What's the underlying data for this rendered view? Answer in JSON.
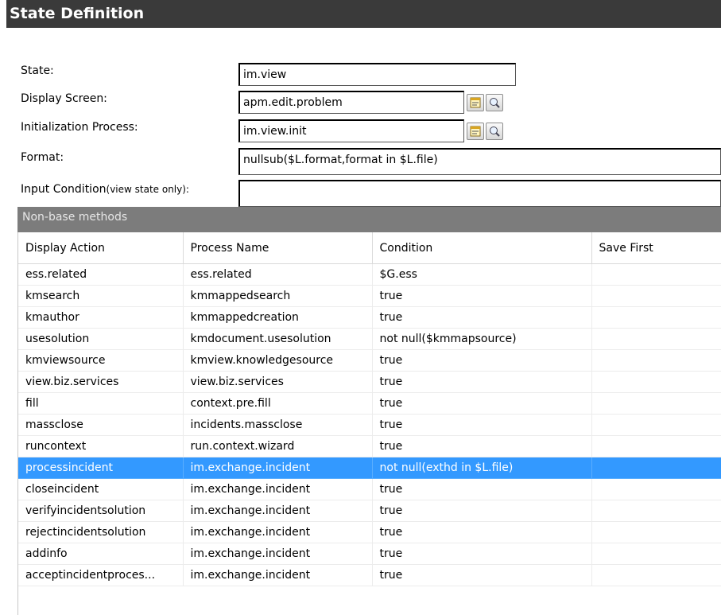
{
  "title": "State Definition",
  "fields": {
    "state": {
      "label": "State:",
      "value": "im.view"
    },
    "display_screen": {
      "label": "Display Screen:",
      "value": "apm.edit.problem"
    },
    "init_process": {
      "label": "Initialization Process:",
      "value": "im.view.init"
    },
    "format": {
      "label": "Format:",
      "value": "nullsub($L.format,format in $L.file)"
    },
    "input_condition": {
      "label": "Input Condition",
      "note": "(view state only):",
      "value": ""
    }
  },
  "section": {
    "title": "Non-base methods"
  },
  "table": {
    "columns": [
      "Display Action",
      "Process Name",
      "Condition",
      "Save First"
    ],
    "rows": [
      [
        "ess.related",
        "ess.related",
        "$G.ess",
        ""
      ],
      [
        "kmsearch",
        "kmmappedsearch",
        "true",
        ""
      ],
      [
        "kmauthor",
        "kmmappedcreation",
        "true",
        ""
      ],
      [
        "usesolution",
        "kmdocument.usesolution",
        "not null($kmmapsource)",
        ""
      ],
      [
        "kmviewsource",
        "kmview.knowledgesource",
        "true",
        ""
      ],
      [
        "view.biz.services",
        "view.biz.services",
        "true",
        ""
      ],
      [
        "fill",
        "context.pre.fill",
        "true",
        ""
      ],
      [
        "massclose",
        "incidents.massclose",
        "true",
        ""
      ],
      [
        "runcontext",
        "run.context.wizard",
        "true",
        ""
      ],
      [
        "processincident",
        "im.exchange.incident",
        "not null(exthd in $L.file)",
        ""
      ],
      [
        "closeincident",
        "im.exchange.incident",
        "true",
        ""
      ],
      [
        "verifyincidentsolution",
        "im.exchange.incident",
        "true",
        ""
      ],
      [
        "rejectincidentsolution",
        "im.exchange.incident",
        "true",
        ""
      ],
      [
        "addinfo",
        "im.exchange.incident",
        "true",
        ""
      ],
      [
        "acceptincidentproces...",
        "im.exchange.incident",
        "true",
        ""
      ]
    ],
    "selected_row": 9
  },
  "icons": {
    "lookup_display_screen": "record-lookup-icon",
    "search_display_screen": "magnifier-icon",
    "lookup_init_process": "record-lookup-icon",
    "search_init_process": "magnifier-icon"
  },
  "colors": {
    "title_bar": "#3a3a3a",
    "section_bar": "#7c7c7c",
    "selection": "#3399ff"
  }
}
